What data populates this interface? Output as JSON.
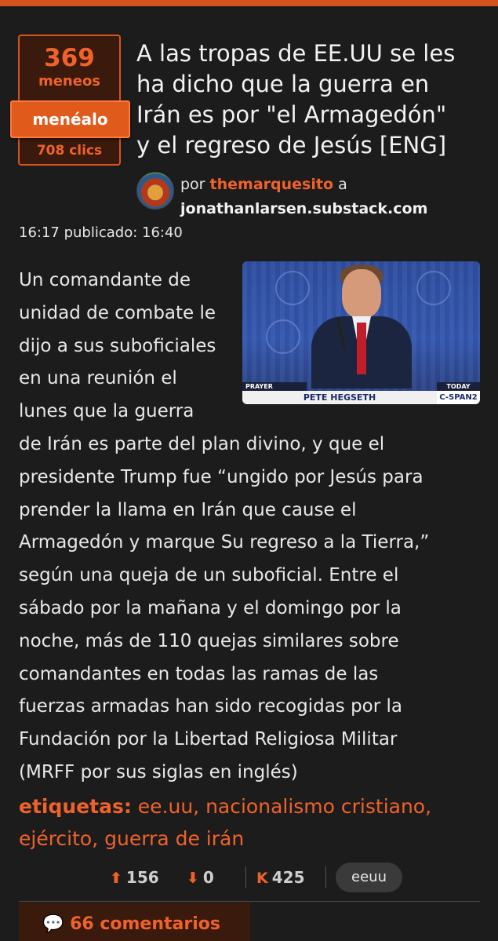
{
  "accent_color": "#d5541d",
  "vote_box": {
    "count": "369",
    "count_label": "meneos",
    "action_label": "menéalo",
    "clicks": "708 clics"
  },
  "story": {
    "title_lines": [
      "A las tropas de EE.UU se les",
      "ha dicho que la guerra en",
      "Irán es por \"el Armagedón\"",
      "y el regreso de Jesús [ENG]"
    ],
    "by_prefix": "por",
    "username": "themarquesito",
    "source_prefix": "a",
    "source": "jonathanlarsen.substack.com",
    "timestamp": "16:17 publicado: 16:40",
    "thumbnail": {
      "tag_left": "PRAYER BREAKFAST",
      "name": "PETE HEGSETH",
      "tag_right": "TODAY",
      "network": "C-SPAN2"
    },
    "body_lines": [
      "Un comandante de",
      "unidad de combate le",
      "dijo a sus suboficiales",
      "en una reunión el",
      "lunes que la guerra",
      "de Irán es parte del plan divino, y que el",
      "presidente Trump fue “ungido por Jesús para",
      "prender la llama en Irán que cause el",
      "Armagedón y marque Su regreso a la Tierra,”",
      "según una queja de un suboficial. Entre el",
      "sábado por la mañana y el domingo por la",
      "noche, más de 110 quejas similares sobre",
      "comandantes en todas las ramas de las",
      "fuerzas armadas han sido recogidas por la",
      "Fundación por la Libertad Religiosa Militar",
      "(MRFF por sus siglas en inglés)"
    ],
    "tags_label": "etiquetas",
    "tags_line1": "ee.uu, nacionalismo cristiano,",
    "tags_line2": "ejército, guerra de irán"
  },
  "stats": {
    "up_icon": "arrow-up-circle-icon",
    "up": "156",
    "down_icon": "arrow-down-circle-icon",
    "down": "0",
    "karma_icon": "K",
    "karma": "425",
    "sub": "eeuu"
  },
  "comments": {
    "icon": "comments-icon",
    "label": "66 comentarios"
  }
}
